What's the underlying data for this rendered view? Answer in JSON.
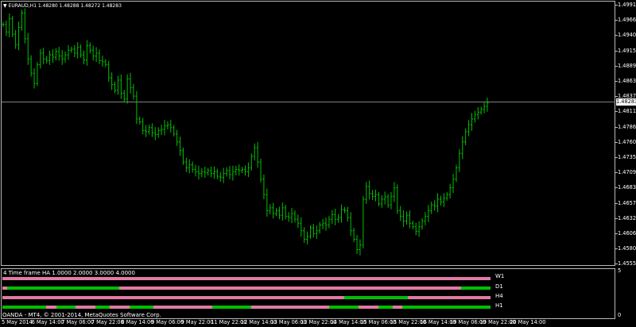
{
  "window": {
    "symbol_header": "EURAUD,H1  1.48280 1.48288 1.48272 1.48283",
    "menu_arrow": "▼"
  },
  "price_axis": {
    "ticks": [
      "1.49915",
      "1.49660",
      "1.49405",
      "1.49150",
      "1.48890",
      "1.48630",
      "1.48375",
      "1.48115",
      "1.47860",
      "1.47605",
      "1.47350",
      "1.47090",
      "1.46835",
      "1.46575",
      "1.46320",
      "1.46065",
      "1.45805",
      "1.45550"
    ],
    "current_price": "1.48283"
  },
  "indicator": {
    "header": "4 Time frame HA 1.0000 2.0000 3.0000 4.0000",
    "axis_top": "5",
    "axis_bottom": "0",
    "rows": [
      {
        "label": "W1"
      },
      {
        "label": "D1"
      },
      {
        "label": "H4"
      },
      {
        "label": "H1"
      }
    ],
    "colors": {
      "bull": "#00c000",
      "bear": "#e07ba3"
    }
  },
  "footer": {
    "copyright": "OANDA - MT4, © 2001-2014, MetaQuotes Software Corp."
  },
  "time_axis": {
    "labels": [
      "5 May 2014",
      "6 May 14:00",
      "7 May 06:00",
      "7 May 22:00",
      "8 May 14:00",
      "9 May 06:00",
      "9 May 22:00",
      "11 May 22:00",
      "12 May 14:00",
      "13 May 06:00",
      "13 May 22:00",
      "14 May 14:00",
      "15 May 06:00",
      "15 May 22:00",
      "16 May 14:00",
      "19 May 06:00",
      "19 May 22:00",
      "20 May 14:00"
    ]
  },
  "chart_data": {
    "type": "bar",
    "symbol": "EURAUD",
    "timeframe": "H1",
    "bar_color": "#00c000",
    "ylim": [
      1.4545,
      1.5005
    ],
    "close_series": [
      1.4965,
      1.4952,
      1.4975,
      1.4948,
      1.493,
      1.496,
      1.4985,
      1.494,
      1.4905,
      1.488,
      1.4862,
      1.4895,
      1.4915,
      1.4905,
      1.4902,
      1.4912,
      1.4908,
      1.4918,
      1.491,
      1.4905,
      1.4912,
      1.492,
      1.4922,
      1.4915,
      1.4925,
      1.4912,
      1.4903,
      1.4928,
      1.492,
      1.491,
      1.4915,
      1.4902,
      1.49,
      1.4895,
      1.4872,
      1.486,
      1.485,
      1.4868,
      1.4845,
      1.4835,
      1.487,
      1.4855,
      1.484,
      1.48,
      1.4795,
      1.478,
      1.4778,
      1.4785,
      1.4776,
      1.4773,
      1.478,
      1.4782,
      1.4788,
      1.479,
      1.4785,
      1.4774,
      1.476,
      1.4745,
      1.4725,
      1.4715,
      1.472,
      1.4712,
      1.4708,
      1.4705,
      1.4708,
      1.4706,
      1.471,
      1.4705,
      1.4708,
      1.47,
      1.4698,
      1.4705,
      1.471,
      1.4703,
      1.4708,
      1.4712,
      1.471,
      1.4712,
      1.4708,
      1.4715,
      1.4735,
      1.475,
      1.4725,
      1.4695,
      1.4668,
      1.464,
      1.4645,
      1.4635,
      1.464,
      1.4632,
      1.4645,
      1.463,
      1.4628,
      1.4635,
      1.4625,
      1.4618,
      1.4605,
      1.459,
      1.4595,
      1.461,
      1.46,
      1.4605,
      1.4615,
      1.4618,
      1.4615,
      1.4625,
      1.4633,
      1.4625,
      1.4628,
      1.4642,
      1.464,
      1.4628,
      1.4605,
      1.459,
      1.4572,
      1.458,
      1.466,
      1.4682,
      1.467,
      1.4665,
      1.4668,
      1.4652,
      1.466,
      1.4664,
      1.465,
      1.4665,
      1.468,
      1.464,
      1.463,
      1.4622,
      1.4632,
      1.4618,
      1.4612,
      1.4604,
      1.4612,
      1.4622,
      1.463,
      1.464,
      1.465,
      1.4648,
      1.466,
      1.4655,
      1.4662,
      1.4668,
      1.468,
      1.4695,
      1.4715,
      1.474,
      1.476,
      1.4778,
      1.479,
      1.48,
      1.4808,
      1.4812,
      1.4817,
      1.4822,
      1.4828
    ]
  }
}
